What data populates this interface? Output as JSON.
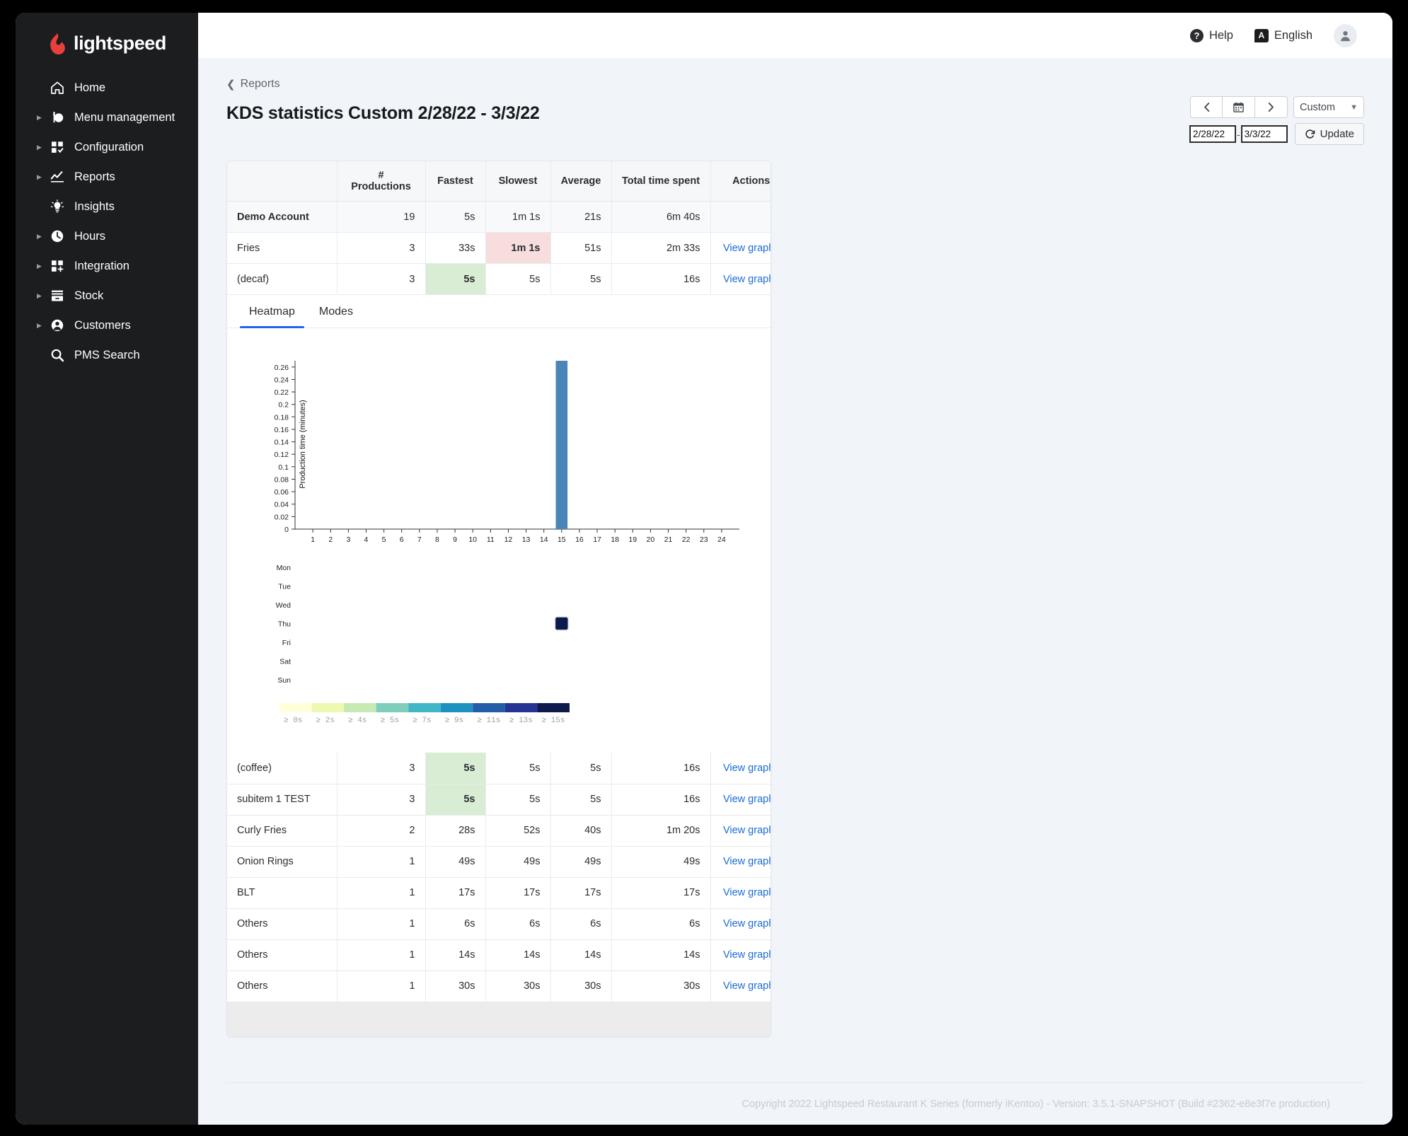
{
  "brand": {
    "name": "lightspeed"
  },
  "sidebar": {
    "items": [
      {
        "label": "Home",
        "icon": "home-icon",
        "expandable": false
      },
      {
        "label": "Menu management",
        "icon": "menu-icon",
        "expandable": true
      },
      {
        "label": "Configuration",
        "icon": "config-icon",
        "expandable": true
      },
      {
        "label": "Reports",
        "icon": "chart-line-icon",
        "expandable": true
      },
      {
        "label": "Insights",
        "icon": "bulb-icon",
        "expandable": false
      },
      {
        "label": "Hours",
        "icon": "clock-icon",
        "expandable": true
      },
      {
        "label": "Integration",
        "icon": "integration-icon",
        "expandable": true
      },
      {
        "label": "Stock",
        "icon": "stock-icon",
        "expandable": true
      },
      {
        "label": "Customers",
        "icon": "user-circle-icon",
        "expandable": true
      },
      {
        "label": "PMS Search",
        "icon": "search-icon",
        "expandable": false
      }
    ]
  },
  "topbar": {
    "help_label": "Help",
    "help_icon": "question-circle-icon",
    "language_label": "English",
    "language_icon": "translate-icon",
    "avatar_icon": "user-avatar-icon"
  },
  "breadcrumb": {
    "label": "Reports",
    "icon": "chevron-left-icon"
  },
  "header": {
    "title": "KDS statistics Custom 2/28/22 - 3/3/22"
  },
  "date_controls": {
    "prev_icon": "chevron-left-icon",
    "calendar_icon": "calendar-icon",
    "next_icon": "chevron-right-icon",
    "range_preset": "Custom",
    "range_preset_options": [
      "Custom"
    ],
    "start_date": "2/28/22",
    "end_date": "3/3/22",
    "separator": "-",
    "update_label": "Update",
    "update_icon": "refresh-icon"
  },
  "table": {
    "columns": [
      "",
      "# Productions",
      "Fastest",
      "Slowest",
      "Average",
      "Total time spent",
      "Actions"
    ],
    "action_label": "View graphs",
    "top_rows": [
      {
        "name": "Demo Account",
        "productions": "19",
        "fastest": "5s",
        "slowest": "1m 1s",
        "average": "21s",
        "total": "6m 40s",
        "action": "",
        "is_account": true,
        "fastest_hl": false,
        "slowest_hl": false
      },
      {
        "name": "Fries",
        "productions": "3",
        "fastest": "33s",
        "slowest": "1m 1s",
        "average": "51s",
        "total": "2m 33s",
        "action": "View graphs",
        "is_account": false,
        "fastest_hl": false,
        "slowest_hl": true
      },
      {
        "name": "(decaf)",
        "productions": "3",
        "fastest": "5s",
        "slowest": "5s",
        "average": "5s",
        "total": "16s",
        "action": "View graphs",
        "is_account": false,
        "fastest_hl": true,
        "slowest_hl": false
      }
    ],
    "bottom_rows": [
      {
        "name": "(coffee)",
        "productions": "3",
        "fastest": "5s",
        "slowest": "5s",
        "average": "5s",
        "total": "16s",
        "action": "View graphs",
        "fastest_hl": true,
        "slowest_hl": false
      },
      {
        "name": "subitem 1 TEST",
        "productions": "3",
        "fastest": "5s",
        "slowest": "5s",
        "average": "5s",
        "total": "16s",
        "action": "View graphs",
        "fastest_hl": true,
        "slowest_hl": false
      },
      {
        "name": "Curly Fries",
        "productions": "2",
        "fastest": "28s",
        "slowest": "52s",
        "average": "40s",
        "total": "1m 20s",
        "action": "View graphs",
        "fastest_hl": false,
        "slowest_hl": false
      },
      {
        "name": "Onion Rings",
        "productions": "1",
        "fastest": "49s",
        "slowest": "49s",
        "average": "49s",
        "total": "49s",
        "action": "View graphs",
        "fastest_hl": false,
        "slowest_hl": false
      },
      {
        "name": "BLT",
        "productions": "1",
        "fastest": "17s",
        "slowest": "17s",
        "average": "17s",
        "total": "17s",
        "action": "View graphs",
        "fastest_hl": false,
        "slowest_hl": false
      },
      {
        "name": "Others",
        "productions": "1",
        "fastest": "6s",
        "slowest": "6s",
        "average": "6s",
        "total": "6s",
        "action": "View graphs",
        "fastest_hl": false,
        "slowest_hl": false
      },
      {
        "name": "Others",
        "productions": "1",
        "fastest": "14s",
        "slowest": "14s",
        "average": "14s",
        "total": "14s",
        "action": "View graphs",
        "fastest_hl": false,
        "slowest_hl": false
      },
      {
        "name": "Others",
        "productions": "1",
        "fastest": "30s",
        "slowest": "30s",
        "average": "30s",
        "total": "30s",
        "action": "View graphs",
        "fastest_hl": false,
        "slowest_hl": false
      }
    ]
  },
  "tabs": [
    {
      "label": "Heatmap",
      "active": true
    },
    {
      "label": "Modes",
      "active": false
    }
  ],
  "chart_data": [
    {
      "type": "bar",
      "title": "",
      "xlabel": "",
      "ylabel": "Production time (minutes)",
      "categories": [
        "1",
        "2",
        "3",
        "4",
        "5",
        "6",
        "7",
        "8",
        "9",
        "10",
        "11",
        "12",
        "13",
        "14",
        "15",
        "16",
        "17",
        "18",
        "19",
        "20",
        "21",
        "22",
        "23",
        "24"
      ],
      "values": [
        0,
        0,
        0,
        0,
        0,
        0,
        0,
        0,
        0,
        0,
        0,
        0,
        0,
        0,
        0.27,
        0,
        0,
        0,
        0,
        0,
        0,
        0,
        0,
        0
      ],
      "ylim": [
        0,
        0.27
      ],
      "yticks": [
        0,
        0.02,
        0.04,
        0.06,
        0.08,
        0.1,
        0.12,
        0.14,
        0.16,
        0.18,
        0.2,
        0.22,
        0.24,
        0.26
      ],
      "ytick_labels": [
        "0",
        "0.02",
        "0.04",
        "0.06",
        "0.08",
        "0.1",
        "0.12",
        "0.14",
        "0.16",
        "0.18",
        "0.2",
        "0.22",
        "0.24",
        "0.26"
      ],
      "grid": false,
      "legend": "none",
      "bar_color": "#4a85b8"
    },
    {
      "type": "heatmap",
      "title": "",
      "xlabel": "",
      "ylabel": "",
      "x": [
        "1",
        "2",
        "3",
        "4",
        "5",
        "6",
        "7",
        "8",
        "9",
        "10",
        "11",
        "12",
        "13",
        "14",
        "15",
        "16",
        "17",
        "18",
        "19",
        "20",
        "21",
        "22",
        "23",
        "24"
      ],
      "y": [
        "Mon",
        "Tue",
        "Wed",
        "Thu",
        "Fri",
        "Sat",
        "Sun"
      ],
      "cells": [
        {
          "x": "15",
          "y": "Thu",
          "value": 16,
          "color": "#0d1b4c"
        }
      ],
      "legend_position": "bottom",
      "legend_labels": [
        "≥ 0s",
        "≥ 2s",
        "≥ 4s",
        "≥ 5s",
        "≥ 7s",
        "≥ 9s",
        "≥ 11s",
        "≥ 13s",
        "≥ 15s"
      ],
      "legend_colors": [
        "#ffffd9",
        "#edf8b1",
        "#c7e9b4",
        "#7fcdbb",
        "#41b6c4",
        "#1d91c0",
        "#225ea8",
        "#253494",
        "#0d1b4c"
      ]
    }
  ],
  "footer": {
    "copyright": "Copyright 2022 Lightspeed Restaurant K Series (formerly iKentoo) - Version: 3.5.1-SNAPSHOT (Build #2362-e8e3f7e production)"
  }
}
